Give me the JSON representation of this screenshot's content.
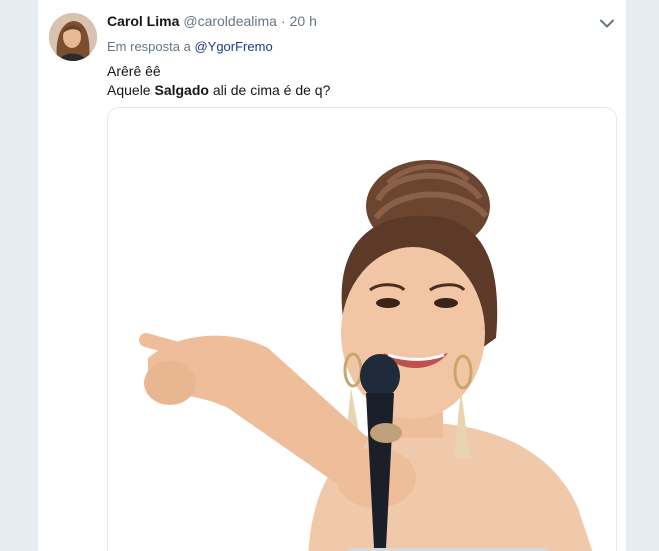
{
  "tweet": {
    "author_name": "Carol Lima",
    "author_handle": "@caroldealima",
    "separator": "·",
    "time": "20 h",
    "reply_prefix": "Em resposta a",
    "reply_to": "@YgorFremo",
    "line1": "Arêrê êê",
    "line2_before": "Aquele",
    "line2_bold": "Salgado",
    "line2_after": "ali de cima é de q?"
  },
  "icons": {
    "menu": "chevron-down-icon",
    "avatar": "profile-photo"
  },
  "colors": {
    "page_bg": "#e6ecf0",
    "card_bg": "#ffffff",
    "muted": "#657786",
    "mention": "#1b3a8c"
  }
}
